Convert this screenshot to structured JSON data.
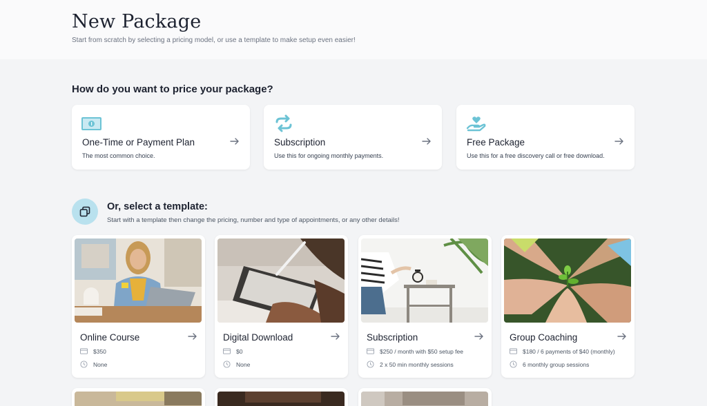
{
  "header": {
    "title": "New Package",
    "subtitle": "Start from scratch by selecting a pricing model, or use a template to make setup even easier!"
  },
  "pricing": {
    "heading": "How do you want to price your package?",
    "options": [
      {
        "title": "One-Time or Payment Plan",
        "description": "The most common choice.",
        "icon": "money-bill-icon"
      },
      {
        "title": "Subscription",
        "description": "Use this for ongoing monthly payments.",
        "icon": "repeat-arrows-icon"
      },
      {
        "title": "Free Package",
        "description": "Use this for a free discovery call or free download.",
        "icon": "heart-hand-icon"
      }
    ]
  },
  "templates": {
    "heading": "Or, select a template:",
    "subheading": "Start with a template then change the pricing, number and type of appointments, or any other details!",
    "items": [
      {
        "name": "Online Course",
        "price": "$350",
        "sessions": "None",
        "image": "woman-laptop-photo"
      },
      {
        "name": "Digital Download",
        "price": "$0",
        "sessions": "None",
        "image": "tablet-stylus-photo"
      },
      {
        "name": "Subscription",
        "price": "$250 / month with $50 setup fee",
        "sessions": "2 x 50 min monthly sessions",
        "image": "alarm-clock-photo"
      },
      {
        "name": "Group Coaching",
        "price": "$180 / 6 payments of $40 (monthly)",
        "sessions": "6 monthly group sessions",
        "image": "hands-plant-photo"
      }
    ]
  },
  "colors": {
    "accent": "#6cc3d5",
    "accent_light": "#b9e1ee",
    "background": "#f3f4f6",
    "text_primary": "#1d2230",
    "text_secondary": "#6b7280"
  }
}
